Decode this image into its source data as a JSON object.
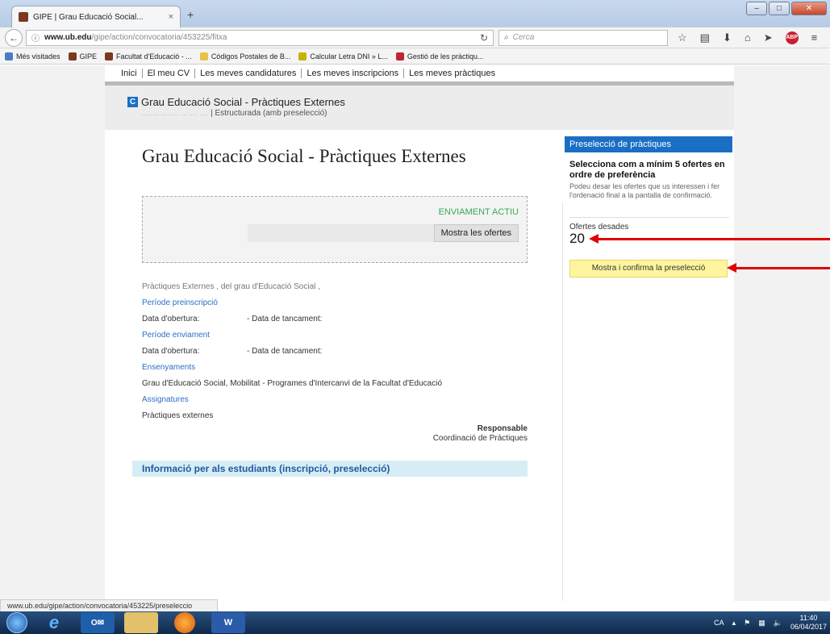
{
  "browser": {
    "tab_title": "GIPE | Grau Educació Social...",
    "tab_close": "×",
    "new_tab": "+",
    "url_host": "www.ub.edu",
    "url_path": "/gipe/action/convocatoria/453225/fitxa",
    "search_placeholder": "Cerca",
    "win_minimize": "–",
    "win_maximize": "□",
    "win_close": "✕",
    "bookmarks": [
      {
        "label": "Més visitades",
        "color": "#4a7cc4"
      },
      {
        "label": "GIPE",
        "color": "#7b3a1f"
      },
      {
        "label": "Facultat d'Educació - ...",
        "color": "#7b3a1f"
      },
      {
        "label": "Códigos Postales de B...",
        "color": "#e8c14a"
      },
      {
        "label": "Calcular Letra DNI » L...",
        "color": "#c9b100"
      },
      {
        "label": "Gestió de les pràctiqu...",
        "color": "#c0272d"
      }
    ],
    "status_url": "www.ub.edu/gipe/action/convocatoria/453225/preseleccio"
  },
  "topmenu": [
    "Inici",
    "El meu CV",
    "Les meves candidatures",
    "Les meves inscripcions",
    "Les meves pràctiques"
  ],
  "header": {
    "badge": "C",
    "title": "Grau Educació Social - Pràctiques Externes",
    "subtitle_blurred": "........ ........ .. .... ....",
    "subtitle": "| Estructurada (amb preselecció)"
  },
  "main": {
    "title": "Grau Educació Social - Pràctiques Externes",
    "env_status": "ENVIAMENT ACTIU",
    "show_offers_button": "Mostra les ofertes",
    "intro": "Pràctiques Externes   , del grau d'Educació Social ,",
    "preinscription_label": "Període preinscripció",
    "open_date_label": "Data d'obertura:",
    "close_date_label": "- Data de tancament:",
    "sending_label": "Període enviament",
    "teachings_label": "Ensenyaments",
    "teachings_value": "Grau d'Educació Social, Mobilitat - Programes d'Intercanvi de la Facultat d'Educació",
    "subjects_label": "Assignatures",
    "subjects_value": "Pràctiques externes",
    "responsible_label": "Responsable",
    "responsible_value": "Coordinació de Pràctiques",
    "info_bar": "Informació per als estudiants (inscripció, preselecció)"
  },
  "sidebar": {
    "header": "Preselecció de pràctiques",
    "strong": "Selecciona com a mínim 5 ofertes en ordre de preferència",
    "desc": "Podeu desar les ofertes que us interessen i fer l'ordenació final a la pantalla de confirmació.",
    "saved_label": "Ofertes desades",
    "saved_count": "20",
    "confirm_button": "Mostra i confirma la preselecció"
  },
  "taskbar": {
    "lang": "CA",
    "time": "11:40",
    "date": "06/04/2017"
  },
  "colors": {
    "accent": "#1a6fc4",
    "active_status": "#3aa85a",
    "confirm_button": "#fff59e",
    "annotation_arrow": "#e00000"
  }
}
